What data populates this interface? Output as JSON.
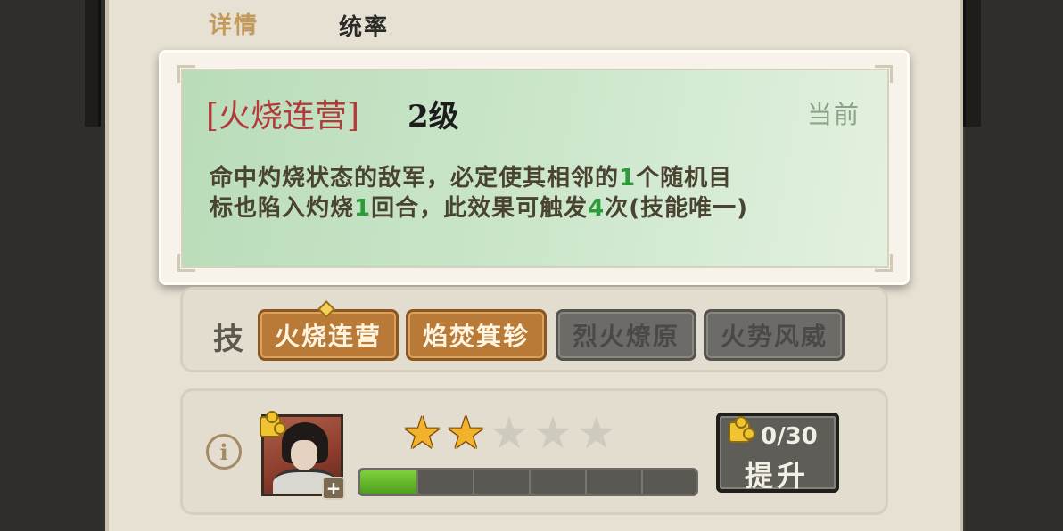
{
  "header": {
    "tab_details": "详情",
    "stat_label": "统率"
  },
  "tooltip": {
    "skill_name": "[火烧连营]",
    "level": "2级",
    "current_label": "当前",
    "desc_line1_a": "命中灼烧状态的敌军，必定使其相邻的",
    "desc_line1_num": "1",
    "desc_line1_b": "个随机目",
    "desc_line2_a": "标也陷入灼烧",
    "desc_line2_num1": "1",
    "desc_line2_b": "回合，此效果可触发",
    "desc_line2_num2": "4",
    "desc_line2_c": "次(技能唯一)"
  },
  "skills": {
    "label": "技",
    "items": [
      {
        "label": "火烧连营",
        "state": "active"
      },
      {
        "label": "焰焚箕轸",
        "state": "active"
      },
      {
        "label": "烈火燎原",
        "state": "locked"
      },
      {
        "label": "火势风威",
        "state": "locked"
      }
    ]
  },
  "hero": {
    "info_icon": "info-icon",
    "stars_filled": 2,
    "stars_total": 5,
    "progress_fraction": 0.17,
    "plus_label": "+",
    "upgrade": {
      "count": "0/30",
      "label": "提升"
    }
  },
  "colors": {
    "accent_red": "#b23a3a",
    "highlight_green": "#2e9b3a",
    "star_gold": "#f2b22c",
    "skill_active": "#b97a37",
    "skill_locked": "#6d6b67"
  }
}
